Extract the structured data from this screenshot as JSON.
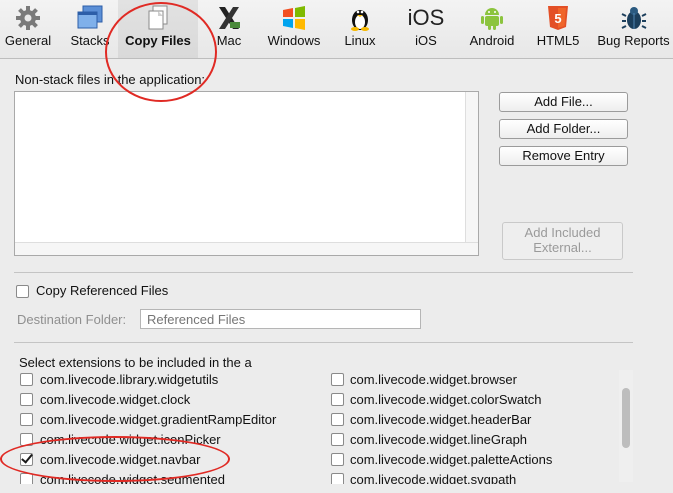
{
  "toolbar": {
    "tabs": [
      {
        "label": "General",
        "icon": "gear-icon"
      },
      {
        "label": "Stacks",
        "icon": "stacks-icon"
      },
      {
        "label": "Copy Files",
        "icon": "copy-files-icon",
        "active": true
      },
      {
        "label": "Mac",
        "icon": "mac-icon"
      },
      {
        "label": "Windows",
        "icon": "windows-icon"
      },
      {
        "label": "Linux",
        "icon": "linux-icon"
      },
      {
        "label": "iOS",
        "icon": "ios-icon"
      },
      {
        "label": "Android",
        "icon": "android-icon"
      },
      {
        "label": "HTML5",
        "icon": "html5-icon"
      },
      {
        "label": "Bug Reports",
        "icon": "bug-icon"
      }
    ]
  },
  "files": {
    "heading": "Non-stack files in the application:",
    "add_file": "Add File...",
    "add_folder": "Add Folder...",
    "remove_entry": "Remove Entry",
    "add_included_line1": "Add Included",
    "add_included_line2": "External..."
  },
  "referenced": {
    "copy_label": "Copy Referenced Files",
    "copy_checked": false,
    "destination_label": "Destination Folder:",
    "destination_placeholder": "Referenced Files"
  },
  "extensions": {
    "heading": "Select extensions to be included in the a",
    "left": [
      {
        "name": "com.livecode.library.widgetutils",
        "checked": false
      },
      {
        "name": "com.livecode.widget.clock",
        "checked": false
      },
      {
        "name": "com.livecode.widget.gradientRampEditor",
        "checked": false
      },
      {
        "name": "com.livecode.widget.iconPicker",
        "checked": false
      },
      {
        "name": "com.livecode.widget.navbar",
        "checked": true
      },
      {
        "name": "com.livecode.widget.segmented",
        "checked": false
      }
    ],
    "right": [
      {
        "name": "com.livecode.widget.browser",
        "checked": false
      },
      {
        "name": "com.livecode.widget.colorSwatch",
        "checked": false
      },
      {
        "name": "com.livecode.widget.headerBar",
        "checked": false
      },
      {
        "name": "com.livecode.widget.lineGraph",
        "checked": false
      },
      {
        "name": "com.livecode.widget.paletteActions",
        "checked": false
      },
      {
        "name": "com.livecode.widget.svgpath",
        "checked": false
      }
    ]
  },
  "colors": {
    "annotation": "#e02a24"
  }
}
